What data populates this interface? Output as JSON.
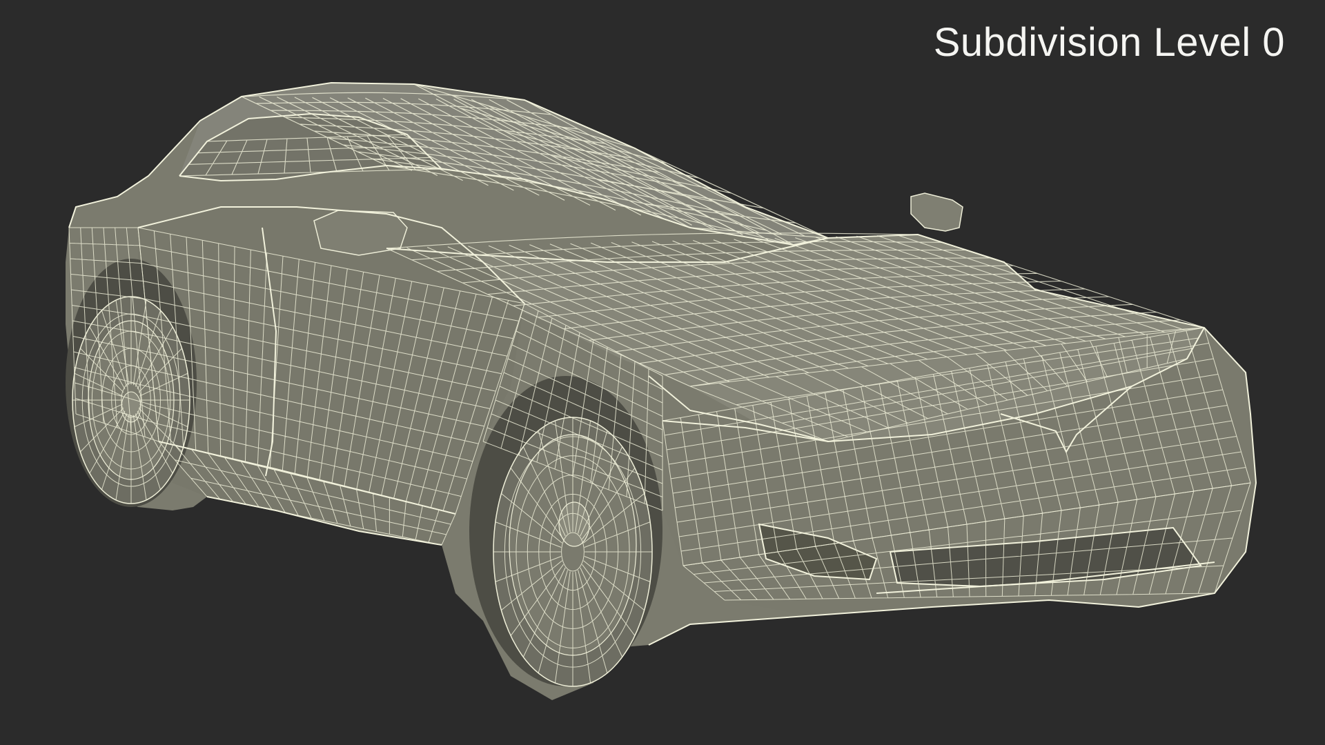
{
  "viewport": {
    "background": "#2b2b2b",
    "label": "Subdivision Level 0"
  },
  "model": {
    "mesh_fill": "#7d7d70",
    "wire_color": "#eeeed8",
    "shadow_color": "#5c5c52"
  }
}
